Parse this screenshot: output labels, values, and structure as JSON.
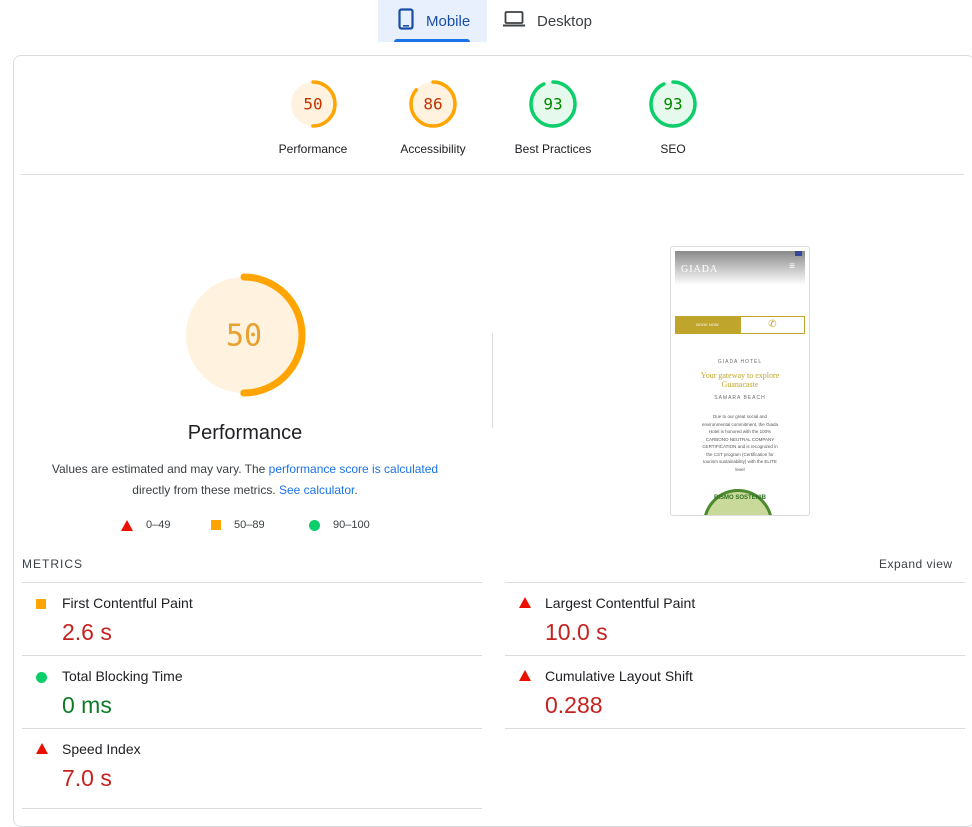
{
  "tabs": [
    {
      "label": "Mobile",
      "icon": "phone-icon",
      "active": true
    },
    {
      "label": "Desktop",
      "icon": "laptop-icon",
      "active": false
    }
  ],
  "scores": [
    {
      "label": "Performance",
      "value": "50",
      "fraction": 0.5,
      "color": "#ffa400",
      "text_color": "#c33300",
      "bg": "#fff3e0"
    },
    {
      "label": "Accessibility",
      "value": "86",
      "fraction": 0.86,
      "color": "#ffa400",
      "text_color": "#c33300",
      "bg": "#fff3e0"
    },
    {
      "label": "Best Practices",
      "value": "93",
      "fraction": 0.93,
      "color": "#0cce6b",
      "text_color": "#008800",
      "bg": "#e6f9ed"
    },
    {
      "label": "SEO",
      "value": "93",
      "fraction": 0.93,
      "color": "#0cce6b",
      "text_color": "#008800",
      "bg": "#e6f9ed"
    }
  ],
  "performance": {
    "score": "50",
    "fraction": 0.5,
    "title": "Performance",
    "desc_prefix": "Values are estimated and may vary. The ",
    "desc_link1": "performance score is calculated",
    "desc_mid": " directly from these metrics. ",
    "desc_link2": "See calculator",
    "desc_suffix": "."
  },
  "legend": [
    {
      "range": "0–49",
      "icon": "fail-triangle-icon"
    },
    {
      "range": "50–89",
      "icon": "average-square-icon"
    },
    {
      "range": "90–100",
      "icon": "pass-circle-icon"
    }
  ],
  "screenshot": {
    "brand": "GIADA",
    "book_label": "BOOK NOW",
    "hotel": "GIADA HOTEL",
    "headline_1": "Your gateway to explore",
    "headline_2": "Guanacaste",
    "place": "SAMARA BEACH",
    "body": "Due to our great social and environmental commitment, the Giada Hotel is honored with the 100% CARBONO NEUTRAL COMPANY CERTIFICATION and is recognized in the CST program (Certification for tourism sustainability) with the ELITE level",
    "badge_text": "RISMO SOSTENIB"
  },
  "metrics_label": "METRICS",
  "expand_label": "Expand view",
  "metrics": [
    {
      "name": "First Contentful Paint",
      "value": "2.6 s",
      "status": "average"
    },
    {
      "name": "Largest Contentful Paint",
      "value": "10.0 s",
      "status": "fail"
    },
    {
      "name": "Total Blocking Time",
      "value": "0 ms",
      "status": "pass"
    },
    {
      "name": "Cumulative Layout Shift",
      "value": "0.288",
      "status": "fail"
    },
    {
      "name": "Speed Index",
      "value": "7.0 s",
      "status": "fail"
    }
  ]
}
